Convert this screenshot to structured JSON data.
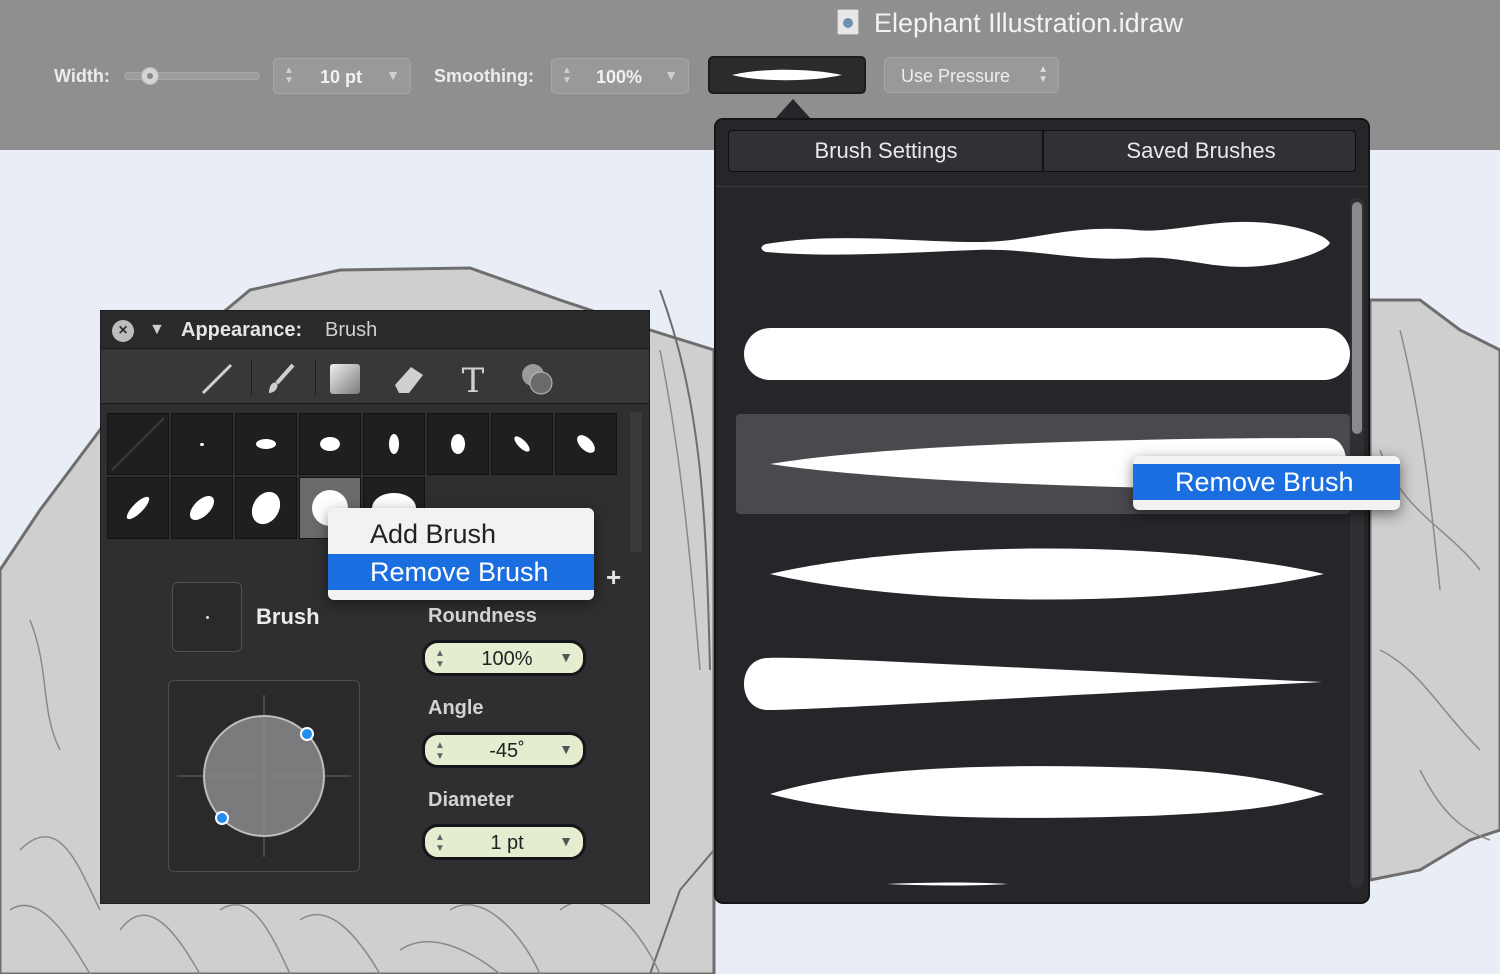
{
  "window": {
    "title": "Elephant Illustration.idraw"
  },
  "toolbar": {
    "width_label": "Width:",
    "width_value": "10 pt",
    "smoothing_label": "Smoothing:",
    "smoothing_value": "100%",
    "pressure_value": "Use Pressure"
  },
  "appearance": {
    "title": "Appearance:",
    "subtitle": "Brush",
    "tools": [
      "line-tool-icon",
      "brush-tool-icon",
      "fill-tool-icon",
      "eraser-tool-icon",
      "text-tool-icon",
      "shape-tool-icon"
    ],
    "context_menu": {
      "add": "Add Brush",
      "remove": "Remove Brush"
    },
    "brush_name": "Brush",
    "roundness_label": "Roundness",
    "roundness_value": "100%",
    "angle_label": "Angle",
    "angle_value": "-45˚",
    "diameter_label": "Diameter",
    "diameter_value": "1 pt"
  },
  "popover": {
    "tab_settings": "Brush Settings",
    "tab_saved": "Saved Brushes",
    "context_menu_remove": "Remove Brush"
  },
  "colors": {
    "accent": "#1b6ee0",
    "panel_bg": "#2f2f31",
    "toolbar_bg": "#8f8f8f"
  }
}
